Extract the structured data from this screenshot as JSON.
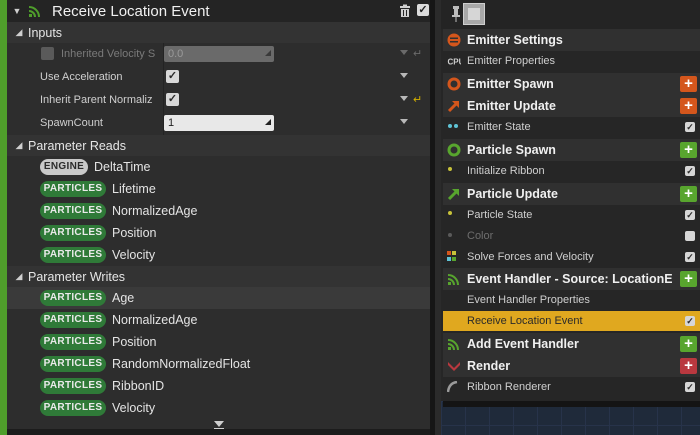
{
  "details": {
    "title": "Receive Location Event",
    "accent_color": "#4f9e2b",
    "icons": {
      "event": "event-handler-icon",
      "delete": "trash-icon"
    },
    "inputs": {
      "label": "Inputs",
      "rows": [
        {
          "label": "Inherited Velocity S",
          "value": "0.0",
          "enabled": false
        },
        {
          "label": "Use Acceleration",
          "checked": true
        },
        {
          "label": "Inherit Parent Normaliz",
          "checked": true
        },
        {
          "label": "SpawnCount",
          "value": "1"
        }
      ]
    },
    "reads": {
      "label": "Parameter Reads",
      "items": [
        {
          "ns": "ENGINE",
          "name": "DeltaTime"
        },
        {
          "ns": "PARTICLES",
          "name": "Lifetime"
        },
        {
          "ns": "PARTICLES",
          "name": "NormalizedAge"
        },
        {
          "ns": "PARTICLES",
          "name": "Position"
        },
        {
          "ns": "PARTICLES",
          "name": "Velocity"
        }
      ]
    },
    "writes": {
      "label": "Parameter Writes",
      "items": [
        {
          "ns": "PARTICLES",
          "name": "Age"
        },
        {
          "ns": "PARTICLES",
          "name": "NormalizedAge"
        },
        {
          "ns": "PARTICLES",
          "name": "Position"
        },
        {
          "ns": "PARTICLES",
          "name": "RandomNormalizedFloat"
        },
        {
          "ns": "PARTICLES",
          "name": "RibbonID"
        },
        {
          "ns": "PARTICLES",
          "name": "Velocity"
        }
      ]
    },
    "badge_colors": {
      "particles": "#2f7a38",
      "engine": "#c9c9c9"
    }
  },
  "stack": {
    "emitter_settings": "Emitter Settings",
    "emitter_properties": "Emitter Properties",
    "emitter_spawn": "Emitter Spawn",
    "emitter_update": "Emitter Update",
    "emitter_state": "Emitter State",
    "particle_spawn": "Particle Spawn",
    "initialize_ribbon": "Initialize Ribbon",
    "particle_update": "Particle Update",
    "particle_state": "Particle State",
    "color": "Color",
    "solve_forces": "Solve Forces and Velocity",
    "event_handler": "Event Handler - Source: LocationEvent",
    "event_handler_props": "Event Handler Properties",
    "receive_location_event": "Receive Location Event",
    "add_event_handler": "Add Event Handler",
    "render": "Render",
    "ribbon_renderer": "Ribbon Renderer",
    "cpu_label": "CPU",
    "colors": {
      "emitter": "#d4561c",
      "particle": "#58a52e",
      "render": "#b9383f",
      "selected": "#e0a81f"
    }
  }
}
